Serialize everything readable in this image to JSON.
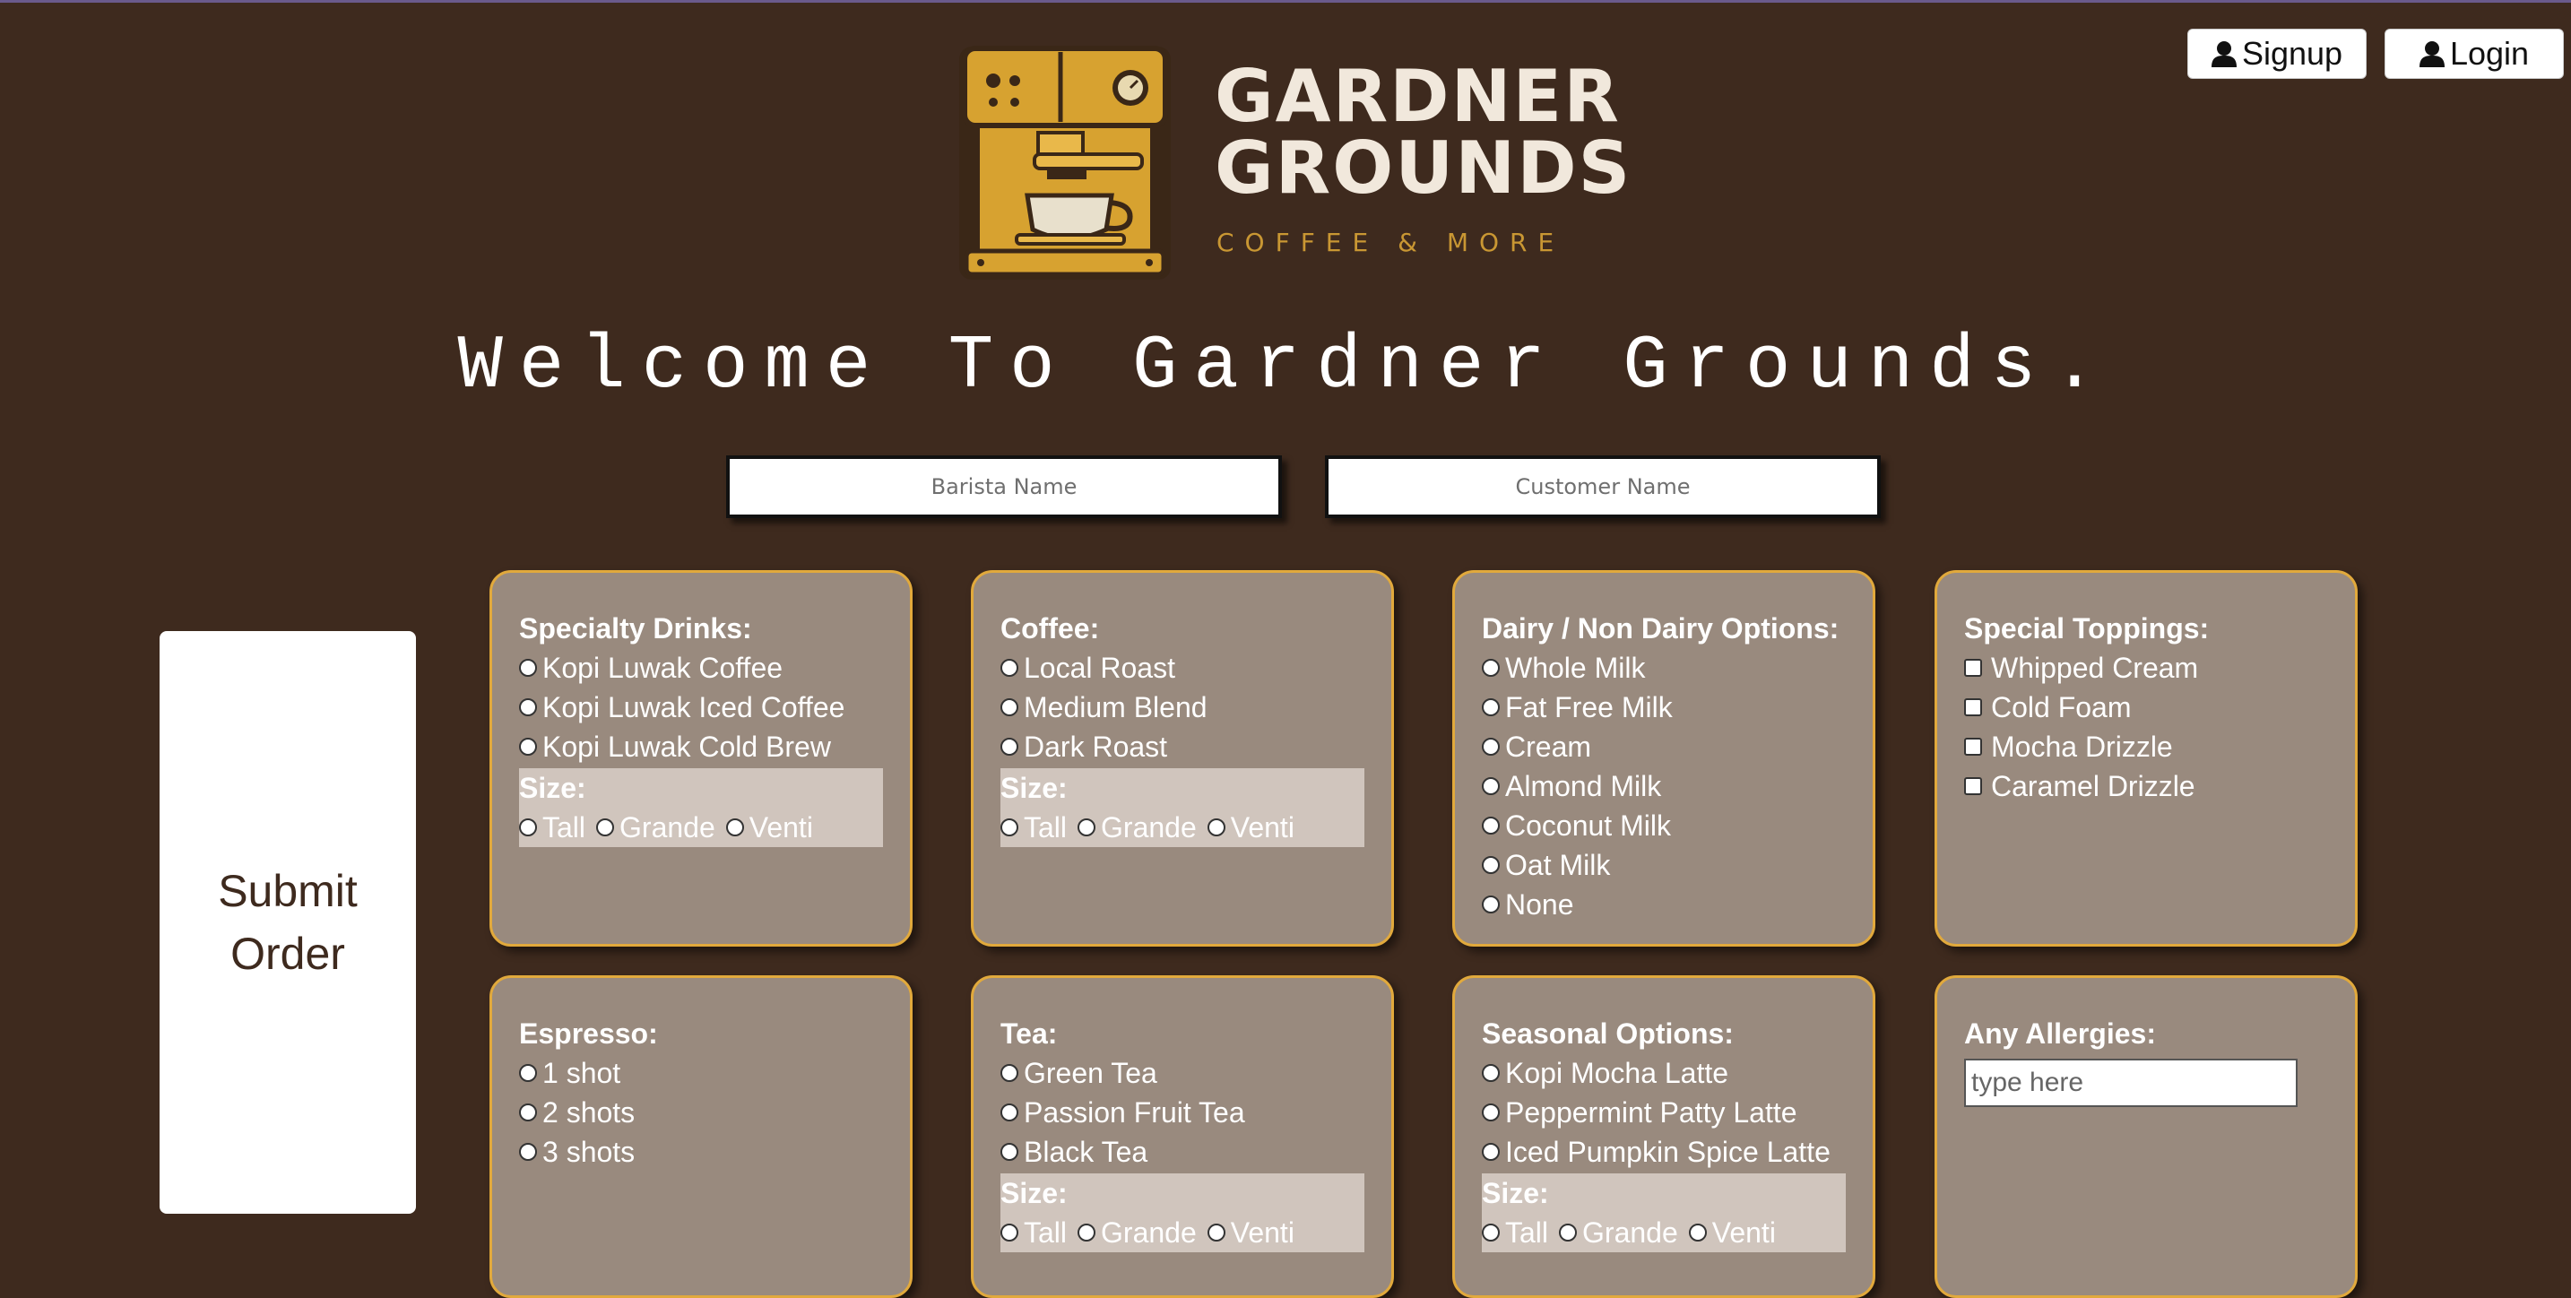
{
  "header": {
    "signup_label": "Signup",
    "login_label": "Login"
  },
  "brand": {
    "line1": "GARDNER",
    "line2": "GROUNDS",
    "tagline": "COFFEE & MORE",
    "logo_icon": "espresso-machine-icon"
  },
  "welcome": "Welcome To Gardner Grounds.",
  "inputs": {
    "barista_placeholder": "Barista Name",
    "customer_placeholder": "Customer Name"
  },
  "submit_label": "Submit Order",
  "sections": {
    "specialty": {
      "title": "Specialty Drinks:",
      "options": [
        "Kopi Luwak Coffee",
        "Kopi Luwak Iced Coffee",
        "Kopi Luwak Cold Brew"
      ],
      "size_title": "Size:",
      "sizes": [
        "Tall",
        "Grande",
        "Venti"
      ]
    },
    "coffee": {
      "title": "Coffee:",
      "options": [
        "Local Roast",
        "Medium Blend",
        "Dark Roast"
      ],
      "size_title": "Size:",
      "sizes": [
        "Tall",
        "Grande",
        "Venti"
      ]
    },
    "dairy": {
      "title": "Dairy / Non Dairy Options:",
      "options": [
        "Whole Milk",
        "Fat Free Milk",
        "Cream",
        "Almond Milk",
        "Coconut Milk",
        "Oat Milk",
        "None"
      ]
    },
    "toppings": {
      "title": "Special Toppings:",
      "options": [
        "Whipped Cream",
        "Cold Foam",
        "Mocha Drizzle",
        "Caramel Drizzle"
      ]
    },
    "espresso": {
      "title": "Espresso:",
      "options": [
        "1 shot",
        "2 shots",
        "3 shots"
      ]
    },
    "tea": {
      "title": "Tea:",
      "options": [
        "Green Tea",
        "Passion Fruit Tea",
        "Black Tea"
      ],
      "size_title": "Size:",
      "sizes": [
        "Tall",
        "Grande",
        "Venti"
      ]
    },
    "seasonal": {
      "title": "Seasonal Options:",
      "options": [
        "Kopi Mocha Latte",
        "Peppermint Patty Latte",
        "Iced Pumpkin Spice Latte"
      ],
      "size_title": "Size:",
      "sizes": [
        "Tall",
        "Grande",
        "Venti"
      ]
    },
    "allergies": {
      "title": "Any Allergies:",
      "placeholder": "type here"
    }
  },
  "colors": {
    "background": "#3e2a1e",
    "card": "#998a7e",
    "card_border": "#e1a93c",
    "size_box": "#d0c5bd",
    "tagline": "#c99733"
  }
}
